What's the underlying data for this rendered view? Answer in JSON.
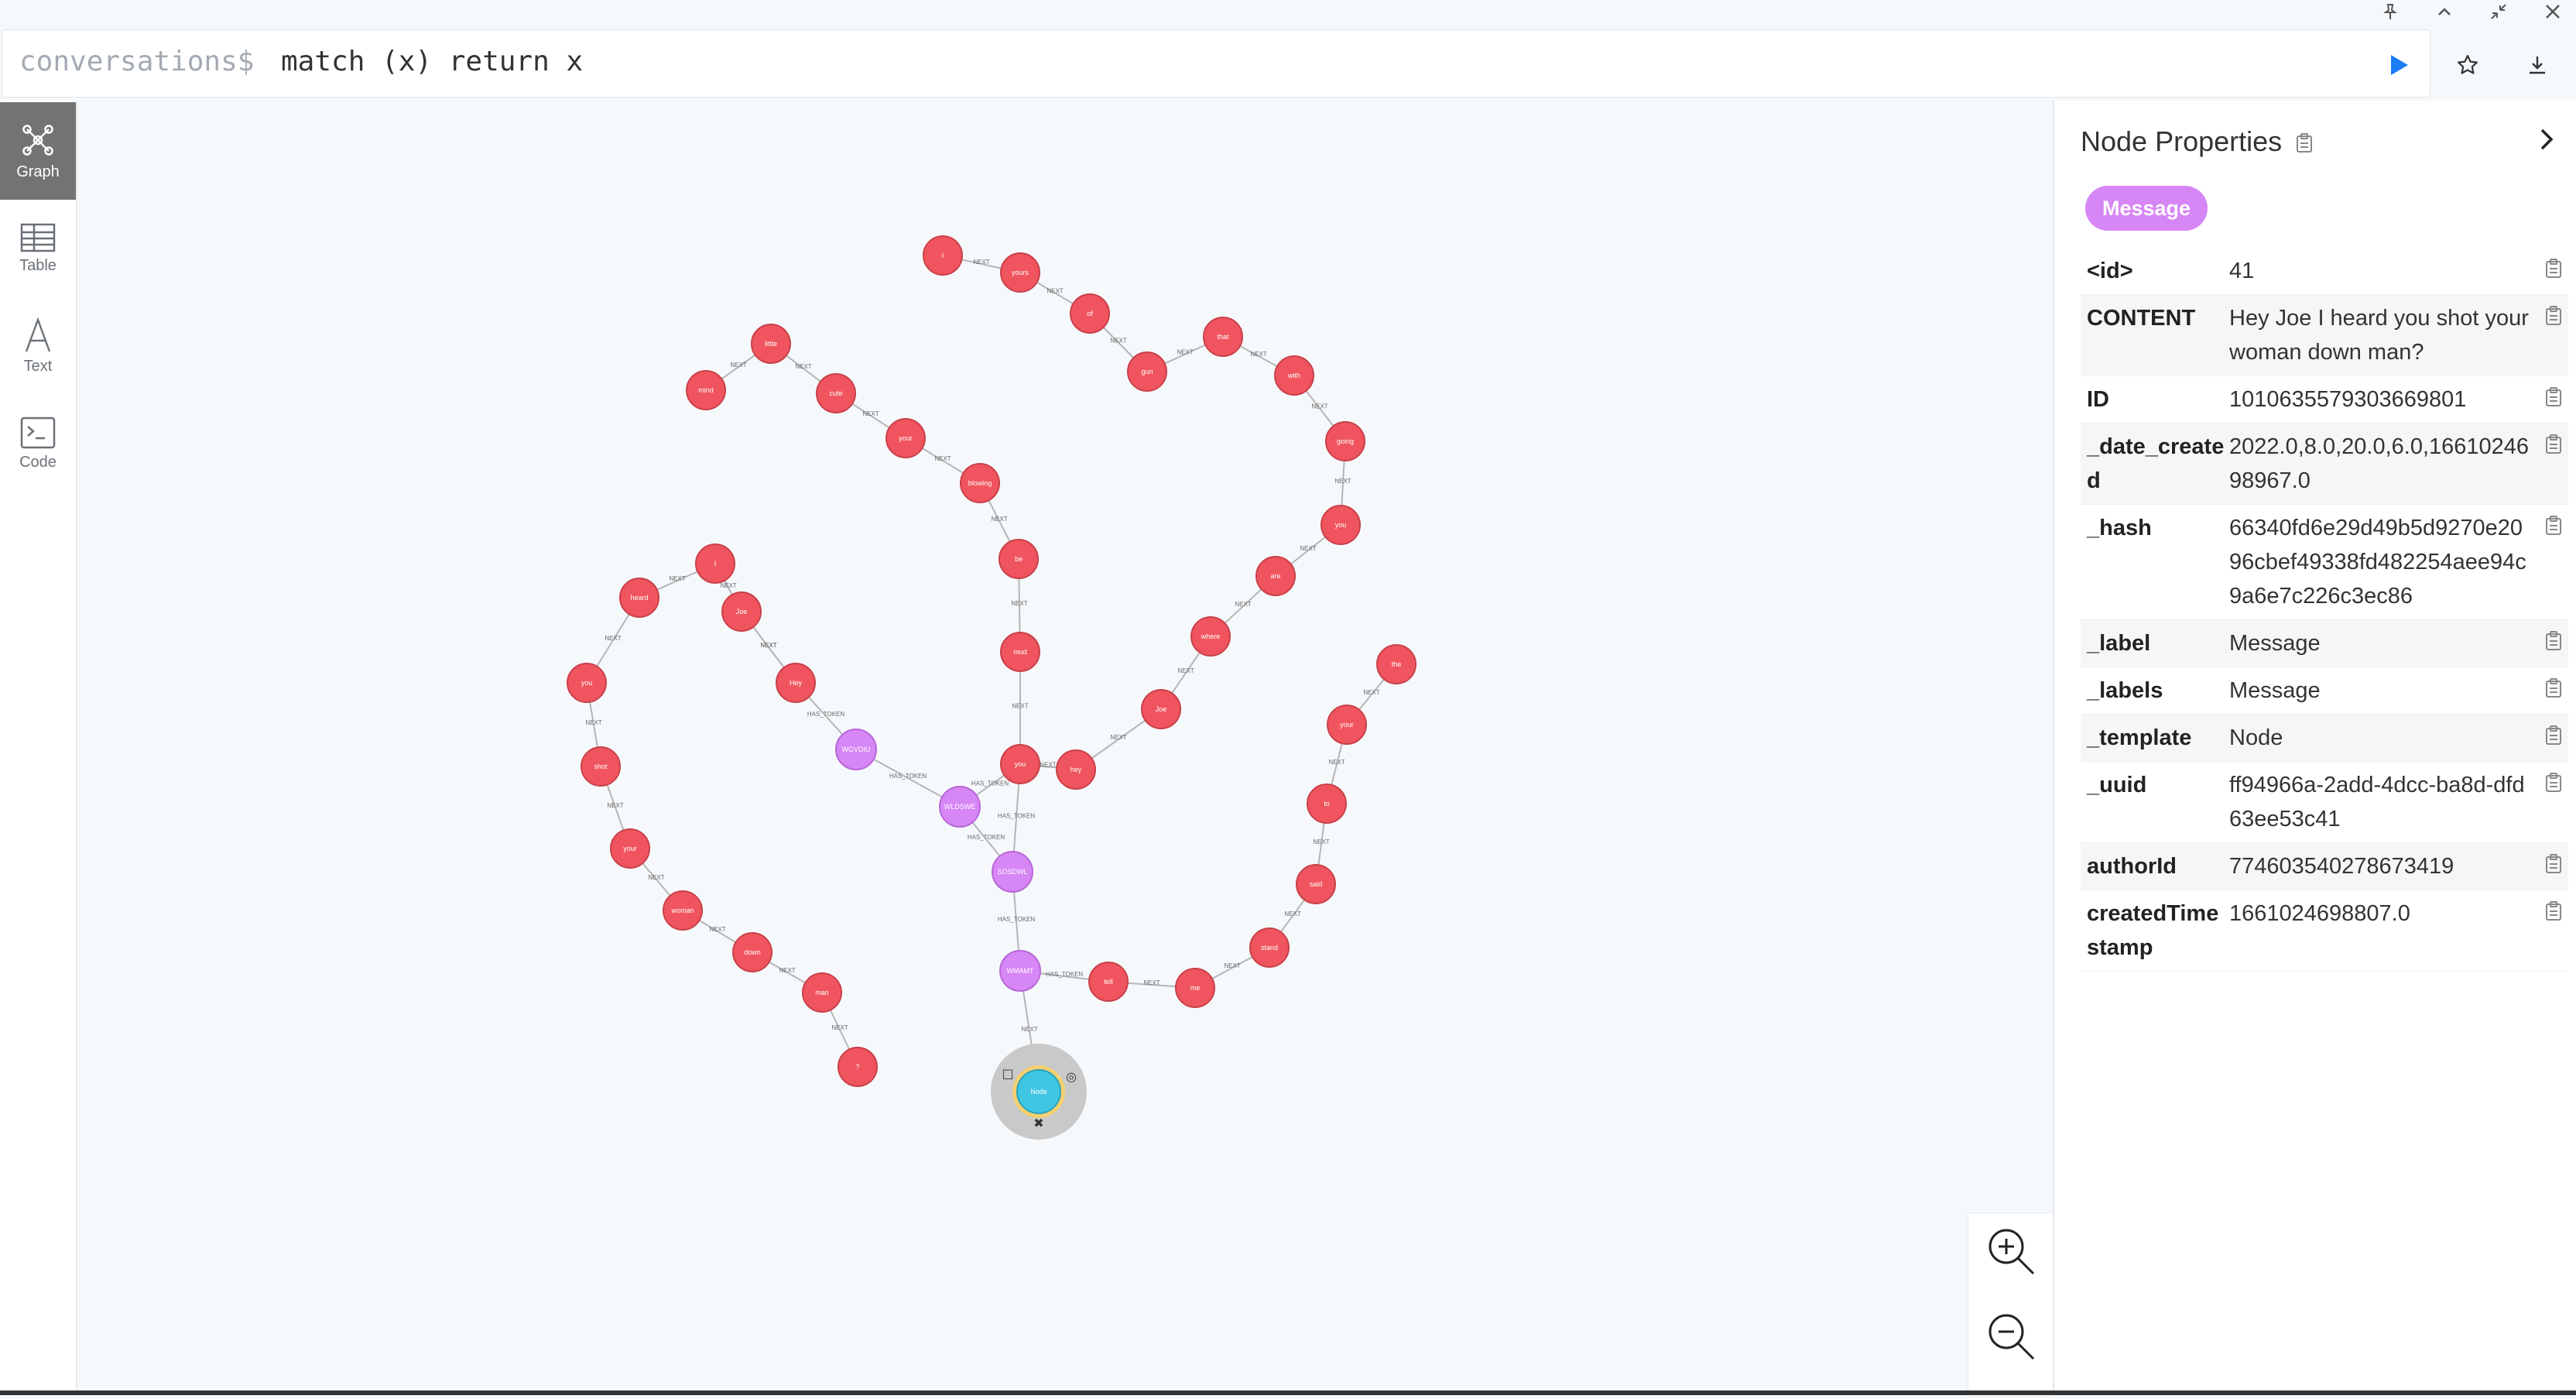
{
  "window": {
    "controls": [
      {
        "icon": "pin-icon"
      },
      {
        "icon": "chevron-up-icon"
      },
      {
        "icon": "shrink-icon"
      },
      {
        "icon": "close-icon"
      }
    ]
  },
  "editor": {
    "prompt": "conversations$",
    "query": "match (x) return x",
    "run_icon": "play-icon",
    "favorite_icon": "star-icon",
    "download_icon": "download-icon"
  },
  "sidebar": {
    "items": [
      {
        "label": "Graph",
        "icon": "graph-icon",
        "active": true
      },
      {
        "label": "Table",
        "icon": "table-icon",
        "active": false
      },
      {
        "label": "Text",
        "icon": "text-icon",
        "active": false
      },
      {
        "label": "Code",
        "icon": "code-icon",
        "active": false
      }
    ]
  },
  "graph": {
    "colors": {
      "token": "#f0555f",
      "message": "#d786f5",
      "selected": "#3fc6e3"
    },
    "tokens": [
      "I",
      "yours",
      "of",
      "gun",
      "that",
      "with",
      "going",
      "you",
      "are",
      "where",
      "Joe",
      "hey",
      "you",
      "mud",
      "be",
      "blowing",
      "your",
      "cute",
      "little",
      "mind",
      "I",
      "heard",
      "you",
      "shot",
      "your",
      "woman",
      "down",
      "man",
      "?",
      "Hey",
      "Joe",
      "the",
      "your",
      "to",
      "said",
      "stand",
      "me",
      "tell"
    ],
    "messages": [
      "WGVDIU",
      "WLDSWE",
      "SOSDWL",
      "WMAMT"
    ],
    "selected_label": "Node"
  },
  "zoom": {
    "in_icon": "zoom-in-icon",
    "out_icon": "zoom-out-icon"
  },
  "panel": {
    "title": "Node Properties",
    "label": "Message",
    "properties": [
      {
        "key": "<id>",
        "value": "41"
      },
      {
        "key": "CONTENT",
        "value": "Hey Joe I heard you shot your woman down man?"
      },
      {
        "key": "ID",
        "value": "1010635579303669801"
      },
      {
        "key": "_date_created",
        "value": "2022.0,8.0,20.0,6.0,1661024698967.0"
      },
      {
        "key": "_hash",
        "value": "66340fd6e29d49b5d9270e2096cbef49338fd482254aee94c9a6e7c226c3ec86"
      },
      {
        "key": "_label",
        "value": "Message"
      },
      {
        "key": "_labels",
        "value": "Message"
      },
      {
        "key": "_template",
        "value": "Node"
      },
      {
        "key": "_uuid",
        "value": "ff94966a-2add-4dcc-ba8d-dfd63ee53c41"
      },
      {
        "key": "authorId",
        "value": "774603540278673419"
      },
      {
        "key": "createdTimestamp",
        "value": "1661024698807.0"
      }
    ]
  }
}
